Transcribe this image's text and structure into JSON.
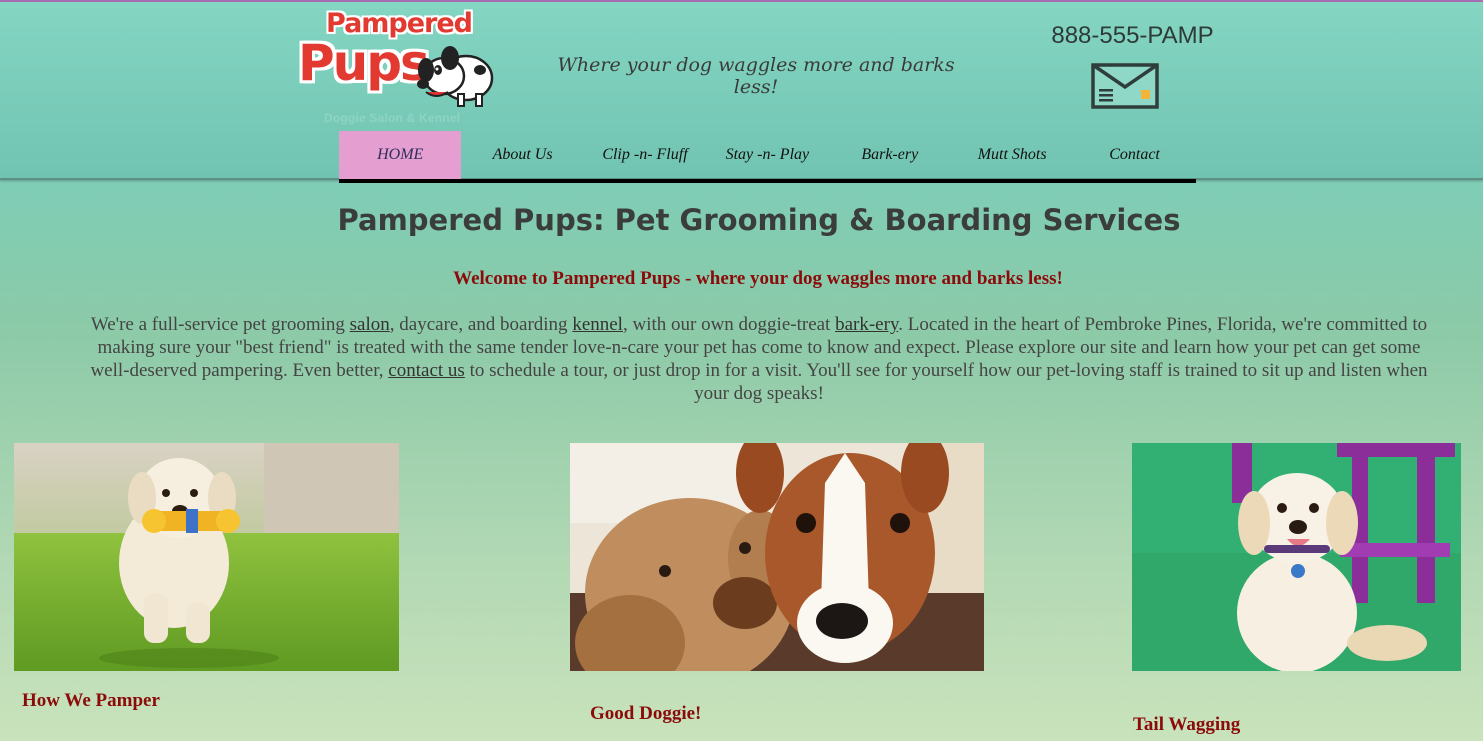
{
  "brand": {
    "logo_word1": "Pampered",
    "logo_word2": "Pups",
    "logo_sub": "Doggie Salon & Kennel"
  },
  "header": {
    "tagline": "Where your dog waggles more and barks less!",
    "phone": "888-555-PAMP",
    "mail_icon": "envelope-icon"
  },
  "nav": {
    "items": [
      {
        "label": "HOME"
      },
      {
        "label": "About Us"
      },
      {
        "label": "Clip -n- Fluff"
      },
      {
        "label": "Stay -n- Play"
      },
      {
        "label": "Bark-ery"
      },
      {
        "label": "Mutt Shots"
      },
      {
        "label": "Contact"
      }
    ],
    "active_index": 0
  },
  "main": {
    "title": "Pampered Pups: Pet Grooming & Boarding Services",
    "welcome": "Welcome to Pampered Pups - where your dog waggles more and barks less!",
    "intro": {
      "p1": "We're a full-service pet grooming ",
      "link_salon": "salon",
      "p2": ", daycare, and boarding ",
      "link_kennel": "kennel",
      "p3": ", with our own doggie-treat ",
      "link_barkery": "bark-ery",
      "p4": ". Located in the heart of Pembroke Pines, Florida, we're committed to making sure your \"best friend\" is treated with the same tender love-n-care your pet has come to know and expect. Please explore our site and learn how your pet can get some well-deserved pampering. Even better, ",
      "link_contact": "contact us",
      "p5": " to schedule a tour, or just drop in for a visit. You'll see for yourself how our pet-loving staff is trained to sit up and listen when your dog speaks!"
    },
    "cards": [
      {
        "title": "How We Pamper",
        "photo": "puppy-with-toy-photo"
      },
      {
        "title": "Good Doggie!",
        "photo": "dog-with-plush-photo"
      },
      {
        "title": "Tail Wagging",
        "photo": "golden-puppy-photo"
      }
    ]
  },
  "colors": {
    "accent_red": "#8b0a0a",
    "nav_active": "#e49ed0",
    "logo_red": "#e23a30"
  }
}
